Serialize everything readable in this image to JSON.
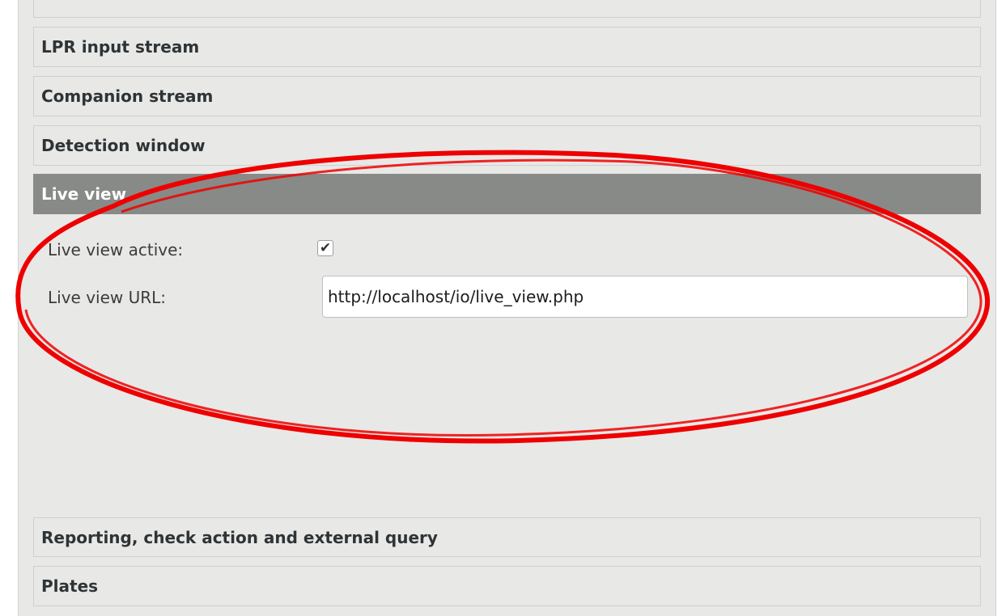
{
  "sections": {
    "cut_off_label": "",
    "lpr_input_stream": "LPR input stream",
    "companion_stream": "Companion stream",
    "detection_window": "Detection window",
    "live_view": "Live view",
    "reporting": "Reporting, check action and external query",
    "plates": "Plates"
  },
  "live_view": {
    "active_label": "Live view active:",
    "active_checked": true,
    "checkbox_glyph": "✔",
    "url_label": "Live view URL:",
    "url_value": "http://localhost/io/live_view.php"
  },
  "colors": {
    "panel_bg": "#e8e8e7",
    "active_header_bg": "#888a87",
    "annotation_red": "#ee0000"
  },
  "annotation": {
    "shape": "ellipse",
    "highlights": "live_view"
  }
}
